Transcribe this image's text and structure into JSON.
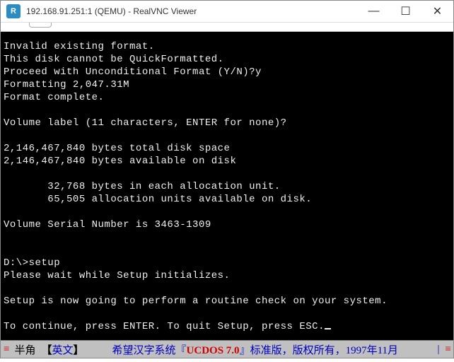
{
  "window": {
    "icon_text": "R",
    "title": "192.168.91.251:1 (QEMU) - RealVNC Viewer",
    "minimize": "—",
    "maximize": "☐",
    "close": "✕"
  },
  "terminal": {
    "lines": [
      "Invalid existing format.",
      "This disk cannot be QuickFormatted.",
      "Proceed with Unconditional Format (Y/N)?y",
      "Formatting 2,047.31M",
      "Format complete.",
      "",
      "Volume label (11 characters, ENTER for none)?",
      "",
      "2,146,467,840 bytes total disk space",
      "2,146,467,840 bytes available on disk",
      "",
      "       32,768 bytes in each allocation unit.",
      "       65,505 allocation units available on disk.",
      "",
      "Volume Serial Number is 3463-1309",
      "",
      "",
      "D:\\>setup",
      "Please wait while Setup initializes.",
      "",
      "Setup is now going to perform a routine check on your system.",
      "",
      "To continue, press ENTER. To quit Setup, press ESC."
    ]
  },
  "statusbar": {
    "left_dbl": "≡",
    "mode": "半角",
    "lang": "英文",
    "prefix": "希望汉字系统『",
    "product": "UCDOS 7.0",
    "suffix": "』标准版，版权所有，1997年11月",
    "pipe": "|",
    "right_dbl": "≡"
  }
}
